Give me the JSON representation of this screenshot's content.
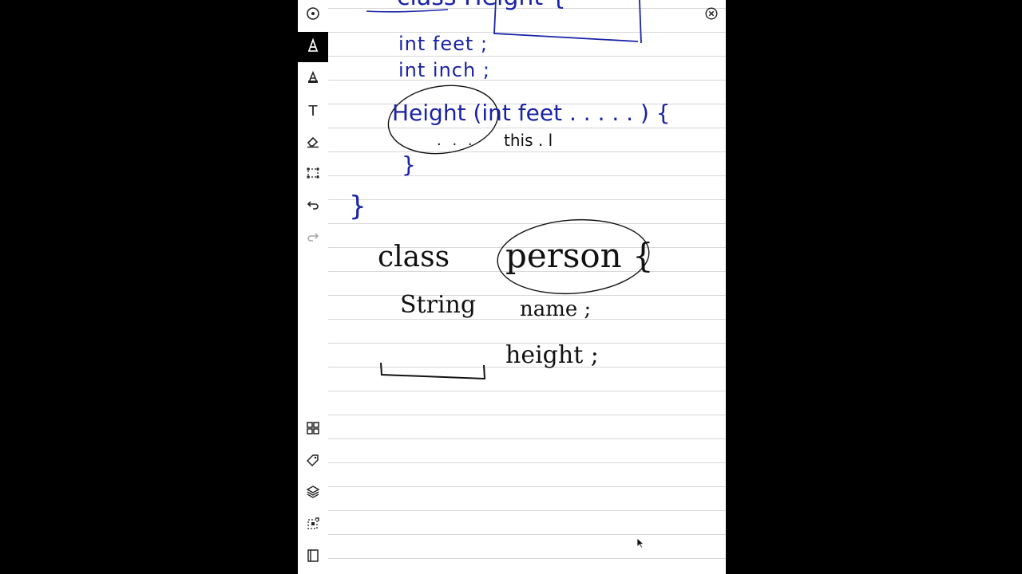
{
  "toolbar": {
    "top": [
      {
        "name": "menu-icon",
        "state": "normal"
      },
      {
        "name": "pen-icon",
        "state": "active"
      },
      {
        "name": "highlighter-icon",
        "state": "normal"
      },
      {
        "name": "text-tool-icon",
        "label": "T",
        "state": "normal"
      },
      {
        "name": "eraser-icon",
        "state": "normal"
      },
      {
        "name": "selection-icon",
        "state": "normal"
      },
      {
        "name": "undo-icon",
        "state": "normal"
      },
      {
        "name": "redo-icon",
        "state": "disabled"
      }
    ],
    "bottom": [
      {
        "name": "grid-view-icon"
      },
      {
        "name": "tag-icon"
      },
      {
        "name": "layers-icon"
      },
      {
        "name": "crop-icon"
      },
      {
        "name": "notebook-icon"
      }
    ]
  },
  "close": {
    "name": "close-icon"
  },
  "ink_colors": {
    "blue": "#1a22a8",
    "black": "#111111"
  },
  "notes": {
    "top_partial": "class Height {",
    "int_feet": "int   feet ;",
    "int_inch": "int   inch ;",
    "constructor": "Height (int feet . . . . . ) {",
    "body_dots": ". . .",
    "this_ref": "this . l",
    "inner_brace_close": "}",
    "outer_brace_close": "}",
    "class_kw": "class",
    "class_name": "person {",
    "string_type": "String",
    "name_field": "name ;",
    "height_field": "height ;"
  }
}
